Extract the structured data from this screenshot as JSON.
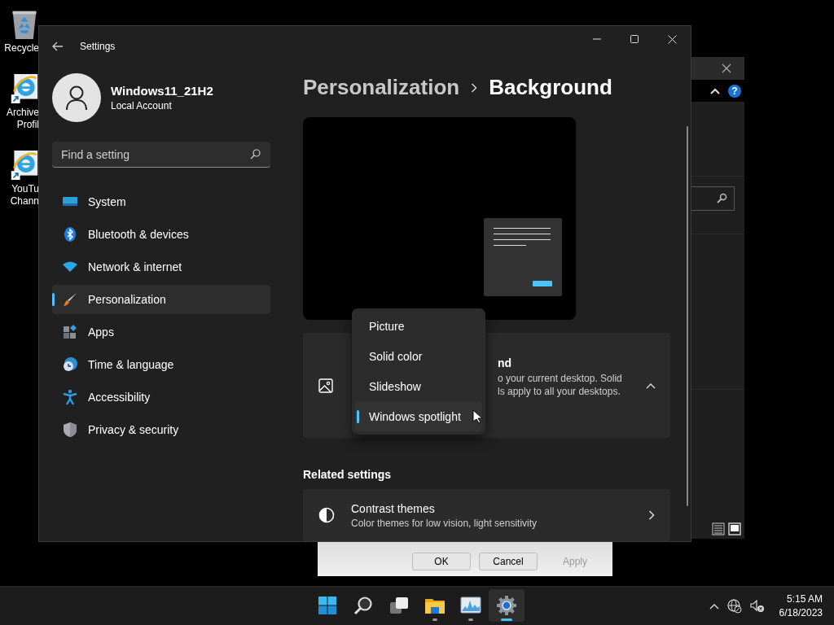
{
  "desktop_icons": [
    {
      "kind": "recycle",
      "label": "Recycle"
    },
    {
      "kind": "browser",
      "label": "Archive Profil"
    },
    {
      "kind": "browser",
      "label": "YouTu Chann"
    }
  ],
  "back_window": {
    "help_glyph": "?"
  },
  "dialog": {
    "buttons": [
      {
        "label": "OK",
        "disabled": false
      },
      {
        "label": "Cancel",
        "disabled": false
      },
      {
        "label": "Apply",
        "disabled": true
      }
    ]
  },
  "settings": {
    "title": "Settings",
    "user": {
      "name": "Windows11_21H2",
      "account": "Local Account"
    },
    "search": {
      "placeholder": "Find a setting"
    },
    "nav": [
      {
        "kind": "system",
        "label": "System",
        "selected": false
      },
      {
        "kind": "bluetooth",
        "label": "Bluetooth & devices",
        "selected": false
      },
      {
        "kind": "network",
        "label": "Network & internet",
        "selected": false
      },
      {
        "kind": "personalization",
        "label": "Personalization",
        "selected": true
      },
      {
        "kind": "apps",
        "label": "Apps",
        "selected": false
      },
      {
        "kind": "time",
        "label": "Time & language",
        "selected": false
      },
      {
        "kind": "accessibility",
        "label": "Accessibility",
        "selected": false
      },
      {
        "kind": "privacy",
        "label": "Privacy & security",
        "selected": false
      }
    ],
    "breadcrumb": {
      "parent": "Personalization",
      "current": "Background"
    },
    "background_card": {
      "title": "nd",
      "description_lines": [
        "o your current desktop. Solid",
        "ls apply to all your desktops."
      ],
      "expanded": true
    },
    "background_menu": {
      "items": [
        {
          "label": "Picture",
          "selected": false
        },
        {
          "label": "Solid color",
          "selected": false
        },
        {
          "label": "Slideshow",
          "selected": false
        },
        {
          "label": "Windows spotlight",
          "selected": true
        }
      ]
    },
    "related": {
      "heading": "Related settings",
      "items": [
        {
          "title": "Contrast themes",
          "subtitle": "Color themes for low vision, light sensitivity"
        }
      ]
    }
  },
  "taskbar": {
    "apps": [
      {
        "kind": "start",
        "selected": false,
        "running": false
      },
      {
        "kind": "search",
        "selected": false,
        "running": false
      },
      {
        "kind": "taskview",
        "selected": false,
        "running": false
      },
      {
        "kind": "folder",
        "selected": false,
        "running": true
      },
      {
        "kind": "monitor",
        "selected": false,
        "running": true
      },
      {
        "kind": "settings",
        "selected": true,
        "running": true
      }
    ],
    "clock": {
      "time": "5:15 AM",
      "date": "6/18/2023"
    }
  }
}
